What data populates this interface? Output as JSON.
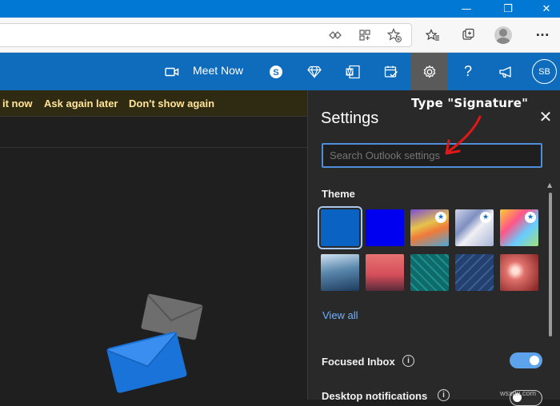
{
  "window": {
    "minimize_glyph": "—",
    "restore_glyph": "❐",
    "close_glyph": "✕"
  },
  "browser": {
    "address_value": "",
    "icons": [
      "read-aloud-icon",
      "apps-icon",
      "add-favorite-icon",
      "favorites-icon",
      "collections-icon",
      "profile-icon",
      "more-icon"
    ],
    "more_glyph": "···"
  },
  "appbar": {
    "meet_now_label": "Meet Now",
    "avatar_initials": "SB",
    "icons": [
      "meet-now-icon",
      "skype-icon",
      "premium-diamond-icon",
      "office-word-icon",
      "my-day-icon",
      "settings-gear-icon",
      "help-icon",
      "feedback-megaphone-icon"
    ],
    "help_glyph": "?"
  },
  "notice": {
    "actions": [
      "it now",
      "Ask again later",
      "Don't show again"
    ]
  },
  "settings": {
    "title": "Settings",
    "close_glyph": "✕",
    "search_placeholder": "Search Outlook settings",
    "theme_label": "Theme",
    "view_all_label": "View all",
    "focused_inbox_label": "Focused Inbox",
    "focused_inbox_enabled": true,
    "desktop_notifications_label": "Desktop notifications",
    "desktop_notifications_enabled": false,
    "info_glyph": "i",
    "star_glyph": "★",
    "themes": [
      {
        "name": "blue-solid-theme",
        "selected": true,
        "premium": false
      },
      {
        "name": "bright-blue-theme",
        "selected": false,
        "premium": false
      },
      {
        "name": "rainbow-waves-theme",
        "selected": false,
        "premium": true
      },
      {
        "name": "silver-swirl-theme",
        "selected": false,
        "premium": true
      },
      {
        "name": "colorful-art-theme",
        "selected": false,
        "premium": true
      },
      {
        "name": "ocean-wave-theme",
        "selected": false,
        "premium": false
      },
      {
        "name": "palm-sunset-theme",
        "selected": false,
        "premium": false
      },
      {
        "name": "circuit-board-theme",
        "selected": false,
        "premium": false
      },
      {
        "name": "blueprint-theme",
        "selected": false,
        "premium": false
      },
      {
        "name": "red-bokeh-theme",
        "selected": false,
        "premium": false
      }
    ]
  },
  "annotation": {
    "text": "Type \"Signature\""
  },
  "watermark": "wsxdn.com",
  "colors": {
    "brand_blue": "#0f6cbd",
    "title_blue": "#0078d4",
    "panel_bg": "#292929",
    "link_blue": "#6fb0ff",
    "arrow_red": "#e01818"
  }
}
